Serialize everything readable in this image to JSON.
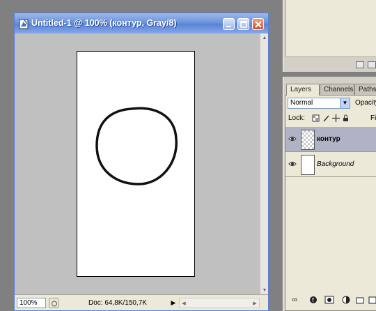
{
  "document": {
    "title": "Untitled-1 @ 100% (контур, Gray/8)",
    "zoom": "100%",
    "info": "Doc: 64,8K/150,7K"
  },
  "layers_panel": {
    "tabs": [
      "Layers",
      "Channels",
      "Paths"
    ],
    "blend_mode": "Normal",
    "opacity_label": "Opacity:",
    "lock_label": "Lock:",
    "fill_label": "Fill",
    "layers": [
      {
        "name": "контур",
        "selected": true,
        "visible": true
      },
      {
        "name": "Background",
        "selected": false,
        "visible": true
      }
    ]
  },
  "colors": {
    "title_bar": "#6e94dc",
    "canvas_bg": "#c0c0c0",
    "selected_layer": "#b0b3c6"
  }
}
